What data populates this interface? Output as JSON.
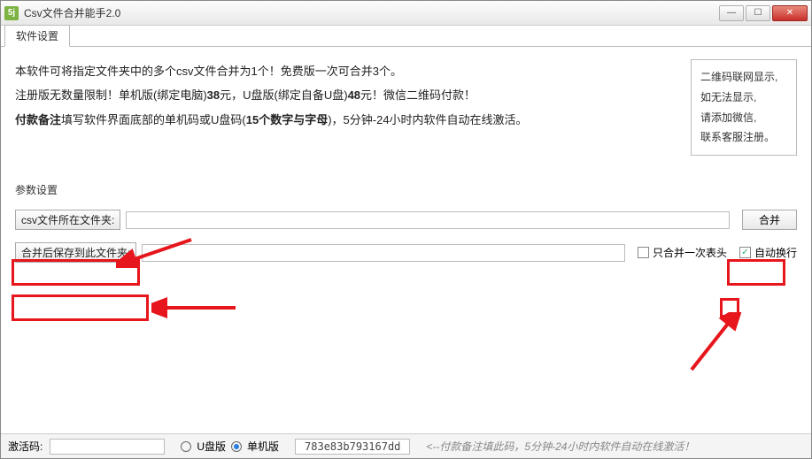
{
  "window": {
    "title": "Csv文件合并能手2.0",
    "icon_text": "5j"
  },
  "tabs": {
    "settings": "软件设置"
  },
  "description": {
    "line1_a": "本软件可将指定文件夹中的多个csv文件合并为1个！免费版一次可合并3个。",
    "line2_a": "注册版无数量限制！单机版(绑定电脑)",
    "line2_price1": "38",
    "line2_b": "元，U盘版(绑定自备U盘)",
    "line2_price2": "48",
    "line2_c": "元！微信二维码付款！",
    "line3_bold": "付款备注",
    "line3_a": "填写软件界面底部的单机码或U盘码(",
    "line3_bold2": "15个数字与字母",
    "line3_b": ")，5分钟-24小时内软件自动在线激活。"
  },
  "qr": {
    "l1": "二维码联网显示,",
    "l2": "如无法显示,",
    "l3": "请添加微信,",
    "l4": "联系客服注册。"
  },
  "params": {
    "label": "参数设置",
    "src_btn": "csv文件所在文件夹:",
    "dst_btn": "合并后保存到此文件夹:",
    "merge_btn": "合并",
    "only_header": "只合并一次表头",
    "auto_wrap": "自动换行"
  },
  "footer": {
    "activation_label": "激活码:",
    "usb_label": "U盘版",
    "single_label": "单机版",
    "machine_code": "783e83b793167dd",
    "hint": "<--付款备注填此码，5分钟-24小时内软件自动在线激活！"
  }
}
